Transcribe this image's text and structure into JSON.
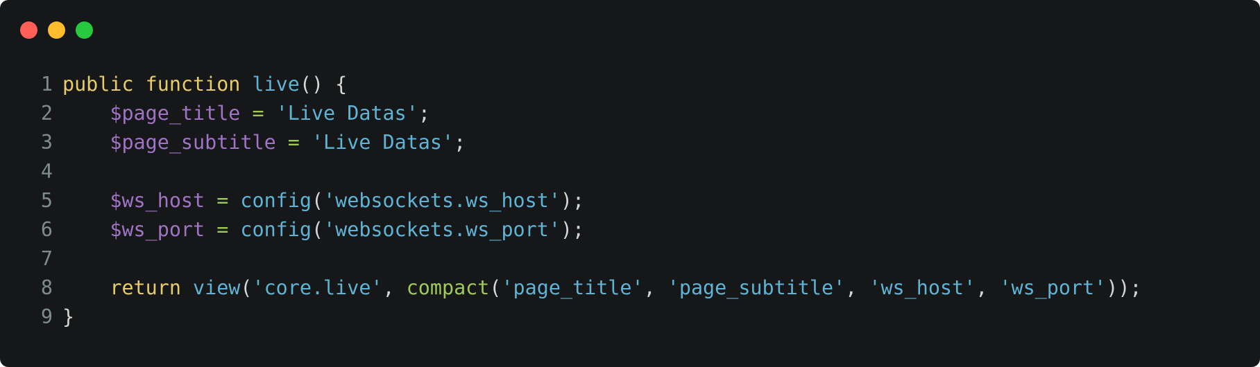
{
  "window": {
    "buttons": {
      "close_color": "#ff5f56",
      "minimize_color": "#ffbd2e",
      "zoom_color": "#27c93f"
    }
  },
  "code": {
    "language": "php",
    "lines": [
      {
        "number": "1",
        "tokens": [
          {
            "t": "public",
            "c": "kw"
          },
          {
            "t": " ",
            "c": "pun"
          },
          {
            "t": "function",
            "c": "kw"
          },
          {
            "t": " ",
            "c": "pun"
          },
          {
            "t": "live",
            "c": "fn"
          },
          {
            "t": "() {",
            "c": "pun"
          }
        ]
      },
      {
        "number": "2",
        "tokens": [
          {
            "t": "    ",
            "c": "pun"
          },
          {
            "t": "$page_title",
            "c": "var"
          },
          {
            "t": " ",
            "c": "pun"
          },
          {
            "t": "=",
            "c": "op"
          },
          {
            "t": " ",
            "c": "pun"
          },
          {
            "t": "'Live Datas'",
            "c": "str"
          },
          {
            "t": ";",
            "c": "pun"
          }
        ]
      },
      {
        "number": "3",
        "tokens": [
          {
            "t": "    ",
            "c": "pun"
          },
          {
            "t": "$page_subtitle",
            "c": "var"
          },
          {
            "t": " ",
            "c": "pun"
          },
          {
            "t": "=",
            "c": "op"
          },
          {
            "t": " ",
            "c": "pun"
          },
          {
            "t": "'Live Datas'",
            "c": "str"
          },
          {
            "t": ";",
            "c": "pun"
          }
        ]
      },
      {
        "number": "4",
        "tokens": []
      },
      {
        "number": "5",
        "tokens": [
          {
            "t": "    ",
            "c": "pun"
          },
          {
            "t": "$ws_host",
            "c": "var"
          },
          {
            "t": " ",
            "c": "pun"
          },
          {
            "t": "=",
            "c": "op"
          },
          {
            "t": " ",
            "c": "pun"
          },
          {
            "t": "config",
            "c": "fn"
          },
          {
            "t": "(",
            "c": "pun"
          },
          {
            "t": "'websockets.ws_host'",
            "c": "str"
          },
          {
            "t": ");",
            "c": "pun"
          }
        ]
      },
      {
        "number": "6",
        "tokens": [
          {
            "t": "    ",
            "c": "pun"
          },
          {
            "t": "$ws_port",
            "c": "var"
          },
          {
            "t": " ",
            "c": "pun"
          },
          {
            "t": "=",
            "c": "op"
          },
          {
            "t": " ",
            "c": "pun"
          },
          {
            "t": "config",
            "c": "fn"
          },
          {
            "t": "(",
            "c": "pun"
          },
          {
            "t": "'websockets.ws_port'",
            "c": "str"
          },
          {
            "t": ");",
            "c": "pun"
          }
        ]
      },
      {
        "number": "7",
        "tokens": []
      },
      {
        "number": "8",
        "tokens": [
          {
            "t": "    ",
            "c": "pun"
          },
          {
            "t": "return",
            "c": "kw"
          },
          {
            "t": " ",
            "c": "pun"
          },
          {
            "t": "view",
            "c": "fn"
          },
          {
            "t": "(",
            "c": "pun"
          },
          {
            "t": "'core.live'",
            "c": "str"
          },
          {
            "t": ", ",
            "c": "pun"
          },
          {
            "t": "compact",
            "c": "op"
          },
          {
            "t": "(",
            "c": "pun"
          },
          {
            "t": "'page_title'",
            "c": "str"
          },
          {
            "t": ", ",
            "c": "pun"
          },
          {
            "t": "'page_subtitle'",
            "c": "str"
          },
          {
            "t": ", ",
            "c": "pun"
          },
          {
            "t": "'ws_host'",
            "c": "str"
          },
          {
            "t": ", ",
            "c": "pun"
          },
          {
            "t": "'ws_port'",
            "c": "str"
          },
          {
            "t": "));",
            "c": "pun"
          }
        ]
      },
      {
        "number": "9",
        "tokens": [
          {
            "t": "}",
            "c": "pun"
          }
        ]
      }
    ]
  }
}
